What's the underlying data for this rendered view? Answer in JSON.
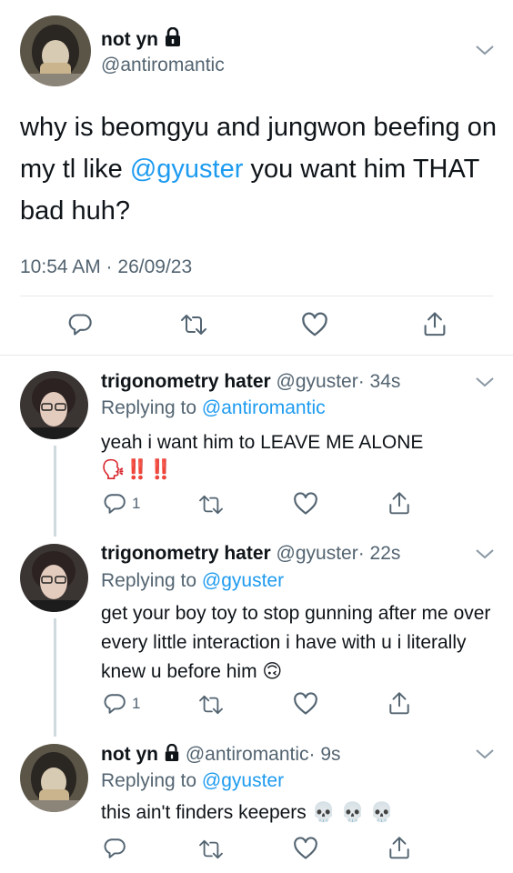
{
  "main_tweet": {
    "name": "not yn",
    "handle": "@antiromantic",
    "text_before": "why is beomgyu and jungwon beefing on my tl like ",
    "mention": "@gyuster",
    "text_after": " you want him THAT bad huh?",
    "timestamp": "10:54 AM · 26/09/23"
  },
  "replies": [
    {
      "name": "trigonometry hater",
      "handle": "@gyuster",
      "time": "· 34s",
      "replying_prefix": "Replying to ",
      "replying_to": "@antiromantic",
      "text": "yeah i want him to LEAVE ME ALONE",
      "emoji_line": "🗣‼️‼️",
      "reply_count": "1"
    },
    {
      "name": "trigonometry hater",
      "handle": "@gyuster",
      "time": "· 22s",
      "replying_prefix": "Replying to ",
      "replying_to": "@gyuster",
      "text": "get your boy toy to stop gunning after me over every little interaction i have with u i literally knew u before him 🙃",
      "reply_count": "1"
    },
    {
      "name": "not yn",
      "handle": "@antiromantic",
      "time": "· 9s",
      "replying_prefix": "Replying to ",
      "replying_to": "@gyuster",
      "text": "this ain't finders keepers 💀 💀 💀",
      "reply_count": ""
    }
  ],
  "colors": {
    "link": "#1d9bf0",
    "muted": "#536471",
    "text": "#0f1419"
  },
  "icons": [
    "lock-icon",
    "chevron-down-icon",
    "reply-icon",
    "retweet-icon",
    "like-icon",
    "share-icon"
  ]
}
